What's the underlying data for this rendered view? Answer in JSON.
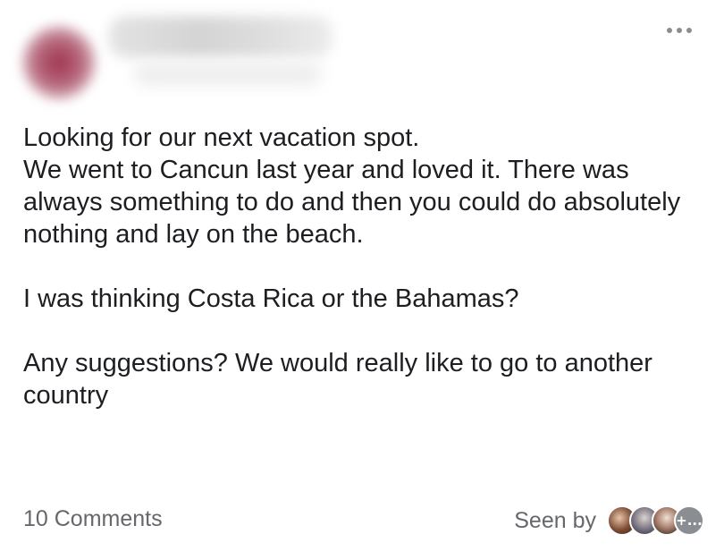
{
  "post": {
    "paragraphs": [
      "Looking for our next vacation spot.\nWe went to Cancun last year and loved it. There was always something to do and then you could do absolutely nothing and lay on the beach.",
      "I was thinking Costa Rica or the Bahamas?",
      "Any suggestions? We would really like to go to another country"
    ]
  },
  "header": {
    "more_icon": "more-horizontal-icon"
  },
  "footer": {
    "comments_label": "10 Comments",
    "seen_by_label": "Seen by",
    "seen_more_label": "+..."
  },
  "colors": {
    "text": "#1c1e21",
    "secondary_text": "#65676b"
  }
}
